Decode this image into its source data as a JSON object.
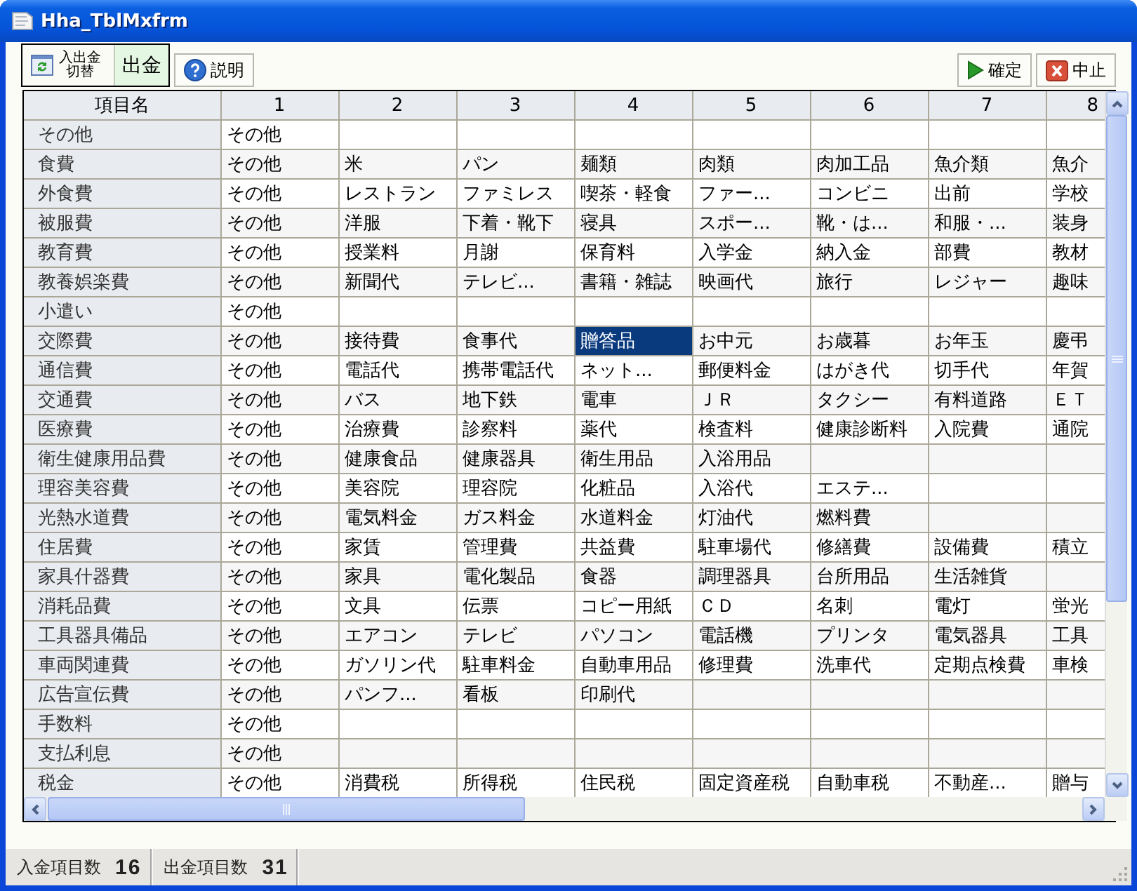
{
  "window": {
    "title": "Hha_TblMxfrm"
  },
  "toolbar": {
    "toggle_button": {
      "label_lines": [
        "入出金",
        "切替"
      ]
    },
    "mode_label": "出金",
    "help_button": "説明",
    "confirm_button": "確定",
    "cancel_button": "中止"
  },
  "table": {
    "row_header_column": "項目名",
    "columns": [
      "1",
      "2",
      "3",
      "4",
      "5",
      "6",
      "7",
      "8"
    ],
    "rows": [
      {
        "name": "その他",
        "cells": [
          {
            "text": "その他",
            "selected": false
          },
          {
            "selected": false
          },
          {
            "selected": false
          },
          {
            "selected": false
          },
          {
            "selected": false
          },
          {
            "selected": false
          },
          {
            "selected": false
          },
          {
            "selected": false
          }
        ]
      },
      {
        "name": "食費",
        "cells": [
          {
            "text": "その他",
            "selected": false
          },
          {
            "text": "米",
            "selected": false
          },
          {
            "text": "パン",
            "selected": false
          },
          {
            "text": "麺類",
            "selected": false
          },
          {
            "text": "肉類",
            "selected": false
          },
          {
            "text": "肉加工品",
            "selected": false
          },
          {
            "text": "魚介類",
            "selected": false
          },
          {
            "text": "魚介",
            "selected": false
          }
        ]
      },
      {
        "name": "外食費",
        "cells": [
          {
            "text": "その他",
            "selected": false
          },
          {
            "text": "レストラン",
            "selected": false
          },
          {
            "text": "ファミレス",
            "selected": false
          },
          {
            "text": "喫茶・軽食",
            "selected": false
          },
          {
            "text": "ファー...",
            "selected": false
          },
          {
            "text": "コンビニ",
            "selected": false
          },
          {
            "text": "出前",
            "selected": false
          },
          {
            "text": "学校",
            "selected": false
          }
        ]
      },
      {
        "name": "被服費",
        "cells": [
          {
            "text": "その他",
            "selected": false
          },
          {
            "text": "洋服",
            "selected": false
          },
          {
            "text": "下着・靴下",
            "selected": false
          },
          {
            "text": "寝具",
            "selected": false
          },
          {
            "text": "スポー...",
            "selected": false
          },
          {
            "text": "靴・は...",
            "selected": false
          },
          {
            "text": "和服・...",
            "selected": false
          },
          {
            "text": "装身",
            "selected": false
          }
        ]
      },
      {
        "name": "教育費",
        "cells": [
          {
            "text": "その他",
            "selected": false
          },
          {
            "text": "授業料",
            "selected": false
          },
          {
            "text": "月謝",
            "selected": false
          },
          {
            "text": "保育料",
            "selected": false
          },
          {
            "text": "入学金",
            "selected": false
          },
          {
            "text": "納入金",
            "selected": false
          },
          {
            "text": "部費",
            "selected": false
          },
          {
            "text": "教材",
            "selected": false
          }
        ]
      },
      {
        "name": "教養娯楽費",
        "cells": [
          {
            "text": "その他",
            "selected": false
          },
          {
            "text": "新聞代",
            "selected": false
          },
          {
            "text": "テレビ...",
            "selected": false
          },
          {
            "text": "書籍・雑誌",
            "selected": false
          },
          {
            "text": "映画代",
            "selected": false
          },
          {
            "text": "旅行",
            "selected": false
          },
          {
            "text": "レジャー",
            "selected": false
          },
          {
            "text": "趣味",
            "selected": false
          }
        ]
      },
      {
        "name": "小遣い",
        "cells": [
          {
            "text": "その他",
            "selected": false
          },
          {
            "selected": false
          },
          {
            "selected": false
          },
          {
            "selected": false
          },
          {
            "selected": false
          },
          {
            "selected": false
          },
          {
            "selected": false
          },
          {
            "selected": false
          }
        ]
      },
      {
        "name": "交際費",
        "cells": [
          {
            "text": "その他",
            "selected": false
          },
          {
            "text": "接待費",
            "selected": false
          },
          {
            "text": "食事代",
            "selected": false
          },
          {
            "text": "贈答品",
            "selected": true
          },
          {
            "text": "お中元",
            "selected": false
          },
          {
            "text": "お歳暮",
            "selected": false
          },
          {
            "text": "お年玉",
            "selected": false
          },
          {
            "text": "慶弔",
            "selected": false
          }
        ]
      },
      {
        "name": "通信費",
        "cells": [
          {
            "text": "その他",
            "selected": false
          },
          {
            "text": "電話代",
            "selected": false
          },
          {
            "text": "携帯電話代",
            "selected": false
          },
          {
            "text": "ネット...",
            "selected": false
          },
          {
            "text": "郵便料金",
            "selected": false
          },
          {
            "text": "はがき代",
            "selected": false
          },
          {
            "text": "切手代",
            "selected": false
          },
          {
            "text": "年賀",
            "selected": false
          }
        ]
      },
      {
        "name": "交通費",
        "cells": [
          {
            "text": "その他",
            "selected": false
          },
          {
            "text": "バス",
            "selected": false
          },
          {
            "text": "地下鉄",
            "selected": false
          },
          {
            "text": "電車",
            "selected": false
          },
          {
            "text": "ＪＲ",
            "selected": false
          },
          {
            "text": "タクシー",
            "selected": false
          },
          {
            "text": "有料道路",
            "selected": false
          },
          {
            "text": "ＥＴ",
            "selected": false
          }
        ]
      },
      {
        "name": "医療費",
        "cells": [
          {
            "text": "その他",
            "selected": false
          },
          {
            "text": "治療費",
            "selected": false
          },
          {
            "text": "診察料",
            "selected": false
          },
          {
            "text": "薬代",
            "selected": false
          },
          {
            "text": "検査料",
            "selected": false
          },
          {
            "text": "健康診断料",
            "selected": false
          },
          {
            "text": "入院費",
            "selected": false
          },
          {
            "text": "通院",
            "selected": false
          }
        ]
      },
      {
        "name": "衛生健康用品費",
        "cells": [
          {
            "text": "その他",
            "selected": false
          },
          {
            "text": "健康食品",
            "selected": false
          },
          {
            "text": "健康器具",
            "selected": false
          },
          {
            "text": "衛生用品",
            "selected": false
          },
          {
            "text": "入浴用品",
            "selected": false
          },
          {
            "selected": false
          },
          {
            "selected": false
          },
          {
            "selected": false
          }
        ]
      },
      {
        "name": "理容美容費",
        "cells": [
          {
            "text": "その他",
            "selected": false
          },
          {
            "text": "美容院",
            "selected": false
          },
          {
            "text": "理容院",
            "selected": false
          },
          {
            "text": "化粧品",
            "selected": false
          },
          {
            "text": "入浴代",
            "selected": false
          },
          {
            "text": "エステ...",
            "selected": false
          },
          {
            "selected": false
          },
          {
            "selected": false
          }
        ]
      },
      {
        "name": "光熱水道費",
        "cells": [
          {
            "text": "その他",
            "selected": false
          },
          {
            "text": "電気料金",
            "selected": false
          },
          {
            "text": "ガス料金",
            "selected": false
          },
          {
            "text": "水道料金",
            "selected": false
          },
          {
            "text": "灯油代",
            "selected": false
          },
          {
            "text": "燃料費",
            "selected": false
          },
          {
            "selected": false
          },
          {
            "selected": false
          }
        ]
      },
      {
        "name": "住居費",
        "cells": [
          {
            "text": "その他",
            "selected": false
          },
          {
            "text": "家賃",
            "selected": false
          },
          {
            "text": "管理費",
            "selected": false
          },
          {
            "text": "共益費",
            "selected": false
          },
          {
            "text": "駐車場代",
            "selected": false
          },
          {
            "text": "修繕費",
            "selected": false
          },
          {
            "text": "設備費",
            "selected": false
          },
          {
            "text": "積立",
            "selected": false
          }
        ]
      },
      {
        "name": "家具什器費",
        "cells": [
          {
            "text": "その他",
            "selected": false
          },
          {
            "text": "家具",
            "selected": false
          },
          {
            "text": "電化製品",
            "selected": false
          },
          {
            "text": "食器",
            "selected": false
          },
          {
            "text": "調理器具",
            "selected": false
          },
          {
            "text": "台所用品",
            "selected": false
          },
          {
            "text": "生活雑貨",
            "selected": false
          },
          {
            "selected": false
          }
        ]
      },
      {
        "name": "消耗品費",
        "cells": [
          {
            "text": "その他",
            "selected": false
          },
          {
            "text": "文具",
            "selected": false
          },
          {
            "text": "伝票",
            "selected": false
          },
          {
            "text": "コピー用紙",
            "selected": false
          },
          {
            "text": "ＣＤ",
            "selected": false
          },
          {
            "text": "名刺",
            "selected": false
          },
          {
            "text": "電灯",
            "selected": false
          },
          {
            "text": "蛍光",
            "selected": false
          }
        ]
      },
      {
        "name": "工具器具備品",
        "cells": [
          {
            "text": "その他",
            "selected": false
          },
          {
            "text": "エアコン",
            "selected": false
          },
          {
            "text": "テレビ",
            "selected": false
          },
          {
            "text": "パソコン",
            "selected": false
          },
          {
            "text": "電話機",
            "selected": false
          },
          {
            "text": "プリンタ",
            "selected": false
          },
          {
            "text": "電気器具",
            "selected": false
          },
          {
            "text": "工具",
            "selected": false
          }
        ]
      },
      {
        "name": "車両関連費",
        "cells": [
          {
            "text": "その他",
            "selected": false
          },
          {
            "text": "ガソリン代",
            "selected": false
          },
          {
            "text": "駐車料金",
            "selected": false
          },
          {
            "text": "自動車用品",
            "selected": false
          },
          {
            "text": "修理費",
            "selected": false
          },
          {
            "text": "洗車代",
            "selected": false
          },
          {
            "text": "定期点検費",
            "selected": false
          },
          {
            "text": "車検",
            "selected": false
          }
        ]
      },
      {
        "name": "広告宣伝費",
        "cells": [
          {
            "text": "その他",
            "selected": false
          },
          {
            "text": "パンフ...",
            "selected": false
          },
          {
            "text": "看板",
            "selected": false
          },
          {
            "text": "印刷代",
            "selected": false
          },
          {
            "selected": false
          },
          {
            "selected": false
          },
          {
            "selected": false
          },
          {
            "selected": false
          }
        ]
      },
      {
        "name": "手数料",
        "cells": [
          {
            "text": "その他",
            "selected": false
          },
          {
            "selected": false
          },
          {
            "selected": false
          },
          {
            "selected": false
          },
          {
            "selected": false
          },
          {
            "selected": false
          },
          {
            "selected": false
          },
          {
            "selected": false
          }
        ]
      },
      {
        "name": "支払利息",
        "cells": [
          {
            "text": "その他",
            "selected": false
          },
          {
            "selected": false
          },
          {
            "selected": false
          },
          {
            "selected": false
          },
          {
            "selected": false
          },
          {
            "selected": false
          },
          {
            "selected": false
          },
          {
            "selected": false
          }
        ]
      },
      {
        "name": "税金",
        "cells": [
          {
            "text": "その他",
            "selected": false
          },
          {
            "text": "消費税",
            "selected": false
          },
          {
            "text": "所得税",
            "selected": false
          },
          {
            "text": "住民税",
            "selected": false
          },
          {
            "text": "固定資産税",
            "selected": false
          },
          {
            "text": "自動車税",
            "selected": false
          },
          {
            "text": "不動産...",
            "selected": false
          },
          {
            "text": "贈与",
            "selected": false
          }
        ]
      }
    ]
  },
  "status_bar": [
    {
      "label": "入金項目数",
      "value": "16"
    },
    {
      "label": "出金項目数",
      "value": "31"
    }
  ]
}
